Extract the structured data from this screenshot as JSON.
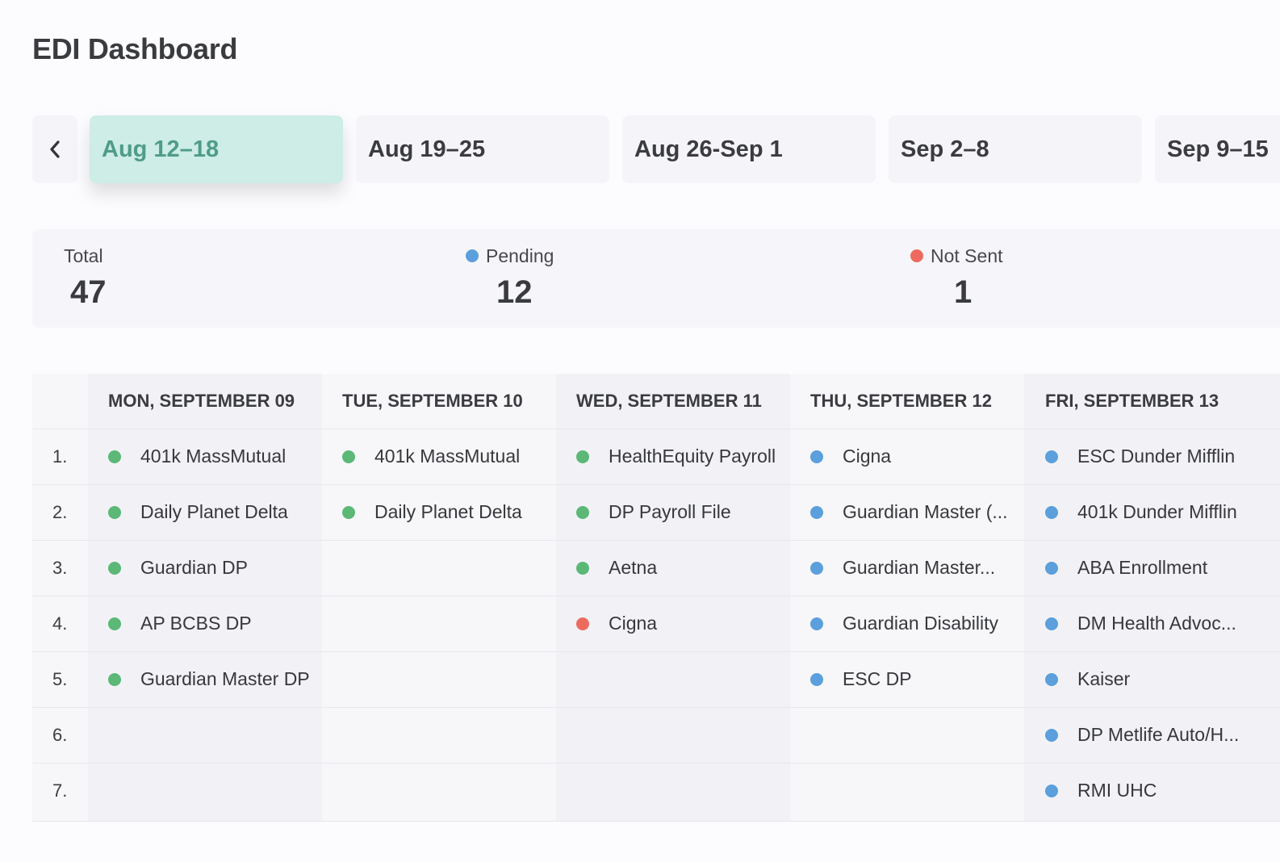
{
  "page": {
    "title": "EDI Dashboard"
  },
  "colors": {
    "sent": "#5bb877",
    "pending": "#5b9fdc",
    "not_sent": "#ec6b5e",
    "active_week_bg": "#cdede6",
    "active_week_text": "#4f9c89"
  },
  "week_nav": {
    "prev_icon": "chevron-left-icon",
    "weeks": [
      {
        "label": "Aug 12–18",
        "active": true
      },
      {
        "label": "Aug 19–25",
        "active": false
      },
      {
        "label": "Aug 26-Sep 1",
        "active": false
      },
      {
        "label": "Sep 2–8",
        "active": false
      },
      {
        "label": "Sep 9–15",
        "active": false
      }
    ]
  },
  "summary": {
    "total": {
      "label": "Total",
      "value": "47"
    },
    "pending": {
      "label": "Pending",
      "value": "12"
    },
    "not_sent": {
      "label": "Not Sent",
      "value": "1"
    }
  },
  "schedule": {
    "row_numbers": [
      "1.",
      "2.",
      "3.",
      "4.",
      "5.",
      "6.",
      "7."
    ],
    "days": [
      {
        "header": "MON, SEPTEMBER 09",
        "items": [
          {
            "name": "401k MassMutual",
            "status": "sent"
          },
          {
            "name": "Daily Planet Delta",
            "status": "sent"
          },
          {
            "name": "Guardian DP",
            "status": "sent"
          },
          {
            "name": "AP BCBS DP",
            "status": "sent"
          },
          {
            "name": "Guardian Master DP",
            "status": "sent"
          }
        ]
      },
      {
        "header": "TUE, SEPTEMBER 10",
        "items": [
          {
            "name": "401k MassMutual",
            "status": "sent"
          },
          {
            "name": "Daily Planet Delta",
            "status": "sent"
          }
        ]
      },
      {
        "header": "WED, SEPTEMBER 11",
        "items": [
          {
            "name": "HealthEquity Payroll",
            "status": "sent"
          },
          {
            "name": "DP Payroll File",
            "status": "sent"
          },
          {
            "name": "Aetna",
            "status": "sent"
          },
          {
            "name": "Cigna",
            "status": "not_sent"
          }
        ]
      },
      {
        "header": "THU, SEPTEMBER 12",
        "items": [
          {
            "name": "Cigna",
            "status": "pending"
          },
          {
            "name": "Guardian Master (...",
            "status": "pending"
          },
          {
            "name": "Guardian Master...",
            "status": "pending"
          },
          {
            "name": "Guardian Disability",
            "status": "pending"
          },
          {
            "name": "ESC DP",
            "status": "pending"
          }
        ]
      },
      {
        "header": "FRI, SEPTEMBER 13",
        "items": [
          {
            "name": "ESC Dunder Mifflin",
            "status": "pending"
          },
          {
            "name": "401k Dunder Mifflin",
            "status": "pending"
          },
          {
            "name": "ABA Enrollment",
            "status": "pending"
          },
          {
            "name": "DM Health Advoc...",
            "status": "pending"
          },
          {
            "name": "Kaiser",
            "status": "pending"
          },
          {
            "name": "DP Metlife Auto/H...",
            "status": "pending"
          },
          {
            "name": "RMI UHC",
            "status": "pending"
          }
        ]
      }
    ]
  }
}
